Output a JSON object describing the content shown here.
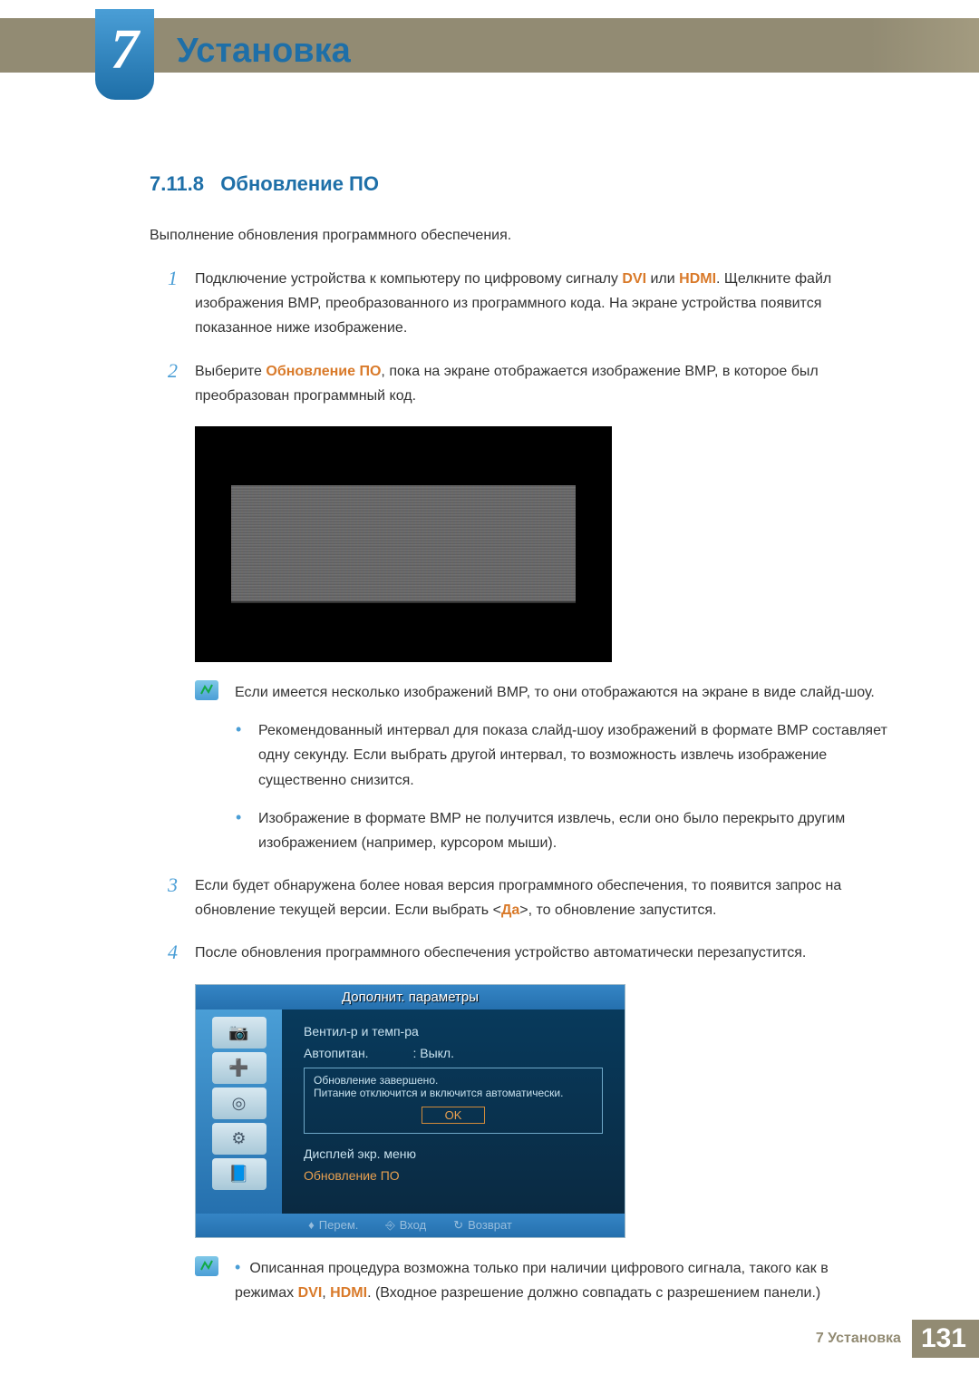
{
  "chapter": {
    "number": "7",
    "title": "Установка"
  },
  "section": {
    "number": "7.11.8",
    "title": "Обновление ПО"
  },
  "intro": "Выполнение обновления программного обеспечения.",
  "steps": {
    "s1": {
      "num": "1",
      "pre": "Подключение устройства к компьютеру по цифровому сигналу ",
      "h1": "DVI",
      "mid1": " или ",
      "h2": "HDMI",
      "post": ". Щелкните файл изображения BMP, преобразованного из программного кода. На экране устройства появится показанное ниже изображение."
    },
    "s2": {
      "num": "2",
      "pre": "Выберите ",
      "h1": "Обновление ПО",
      "post": ", пока на экране отображается изображение BMP, в которое был преобразован программный код."
    },
    "s3": {
      "num": "3",
      "pre": "Если будет обнаружена более новая версия программного обеспечения, то появится запрос на обновление текущей версии. Если выбрать <",
      "h1": "Да",
      "post": ">, то обновление запустится."
    },
    "s4": {
      "num": "4",
      "text": "После обновления программного обеспечения устройство автоматически перезапустится."
    }
  },
  "note1": "Если имеется несколько изображений BMP, то они отображаются на экране в виде слайд-шоу.",
  "bullets": {
    "b1": "Рекомендованный интервал для показа слайд-шоу изображений в формате BMP составляет одну секунду. Если выбрать другой интервал, то возможность извлечь изображение существенно снизится.",
    "b2": "Изображение в формате BMP не получится извлечь, если оно было перекрыто другим изображением (например, курсором мыши)."
  },
  "osd": {
    "header": "Дополнит. параметры",
    "fan": "Вентил-р и темп-ра",
    "auto_label": "Автопитан.",
    "auto_value": ": Выкл.",
    "done": "Обновление завершено.",
    "power": "Питание отключится и включится автоматически.",
    "ok": "OK",
    "display": "Дисплей экр. меню",
    "swupdate": "Обновление ПО",
    "nav_move": "Перем.",
    "nav_enter": "Вход",
    "nav_return": "Возврат"
  },
  "note2": {
    "pre": "Описанная процедура возможна только при наличии цифрового сигнала, такого как в режимах ",
    "h1": "DVI",
    "mid": ", ",
    "h2": "HDMI",
    "post": ". (Входное разрешение должно совпадать с разрешением панели.)"
  },
  "footer": {
    "label": "7 Установка",
    "page": "131"
  }
}
